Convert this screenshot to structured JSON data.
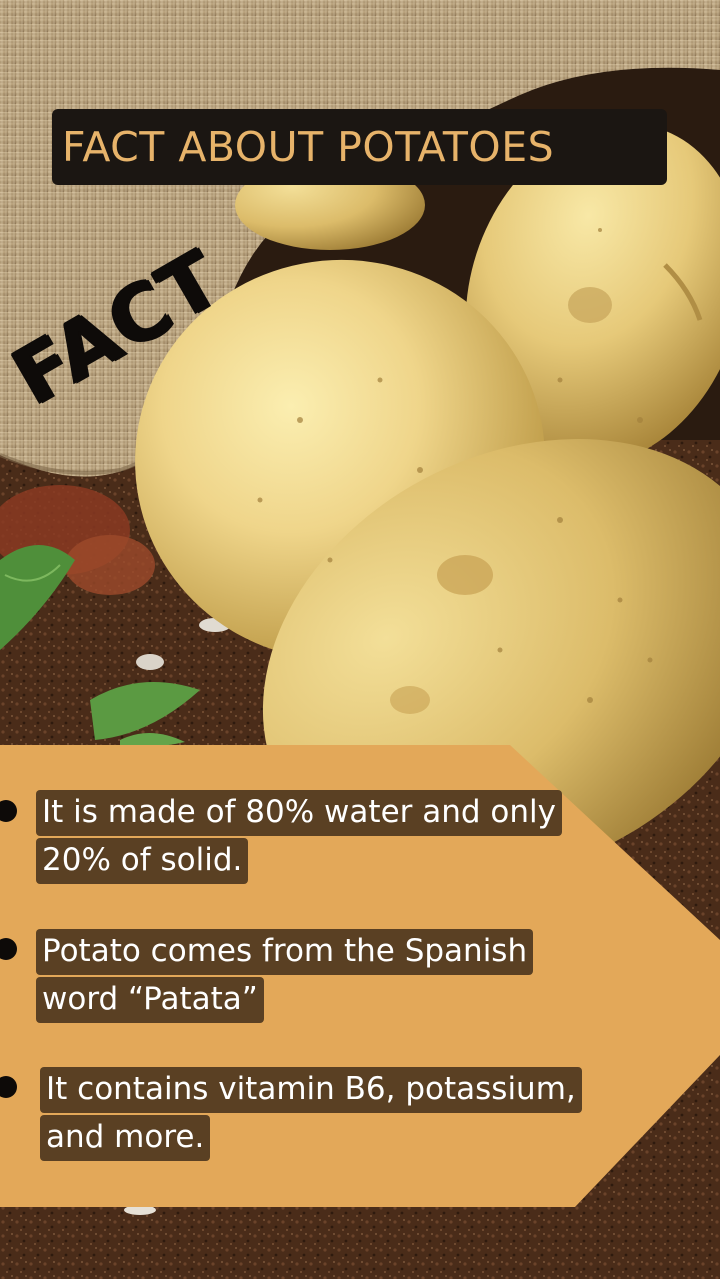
{
  "title": "FACT ABOUT POTATOES",
  "stamp": "FACT",
  "facts": [
    {
      "line1": "It is made of 80% water and only",
      "line2": "20% of solid."
    },
    {
      "line1": "Potato comes from the Spanish",
      "line2": "word “Patata”"
    },
    {
      "line1": "It contains vitamin B6, potassium,",
      "line2": "and more."
    }
  ],
  "colors": {
    "title_background": "#1b1612",
    "title_text": "#e7b36a",
    "panel": "#e3a859",
    "fact_highlight": "#5a4023",
    "fact_text": "#ffffff",
    "bullet": "#0d0a08"
  }
}
